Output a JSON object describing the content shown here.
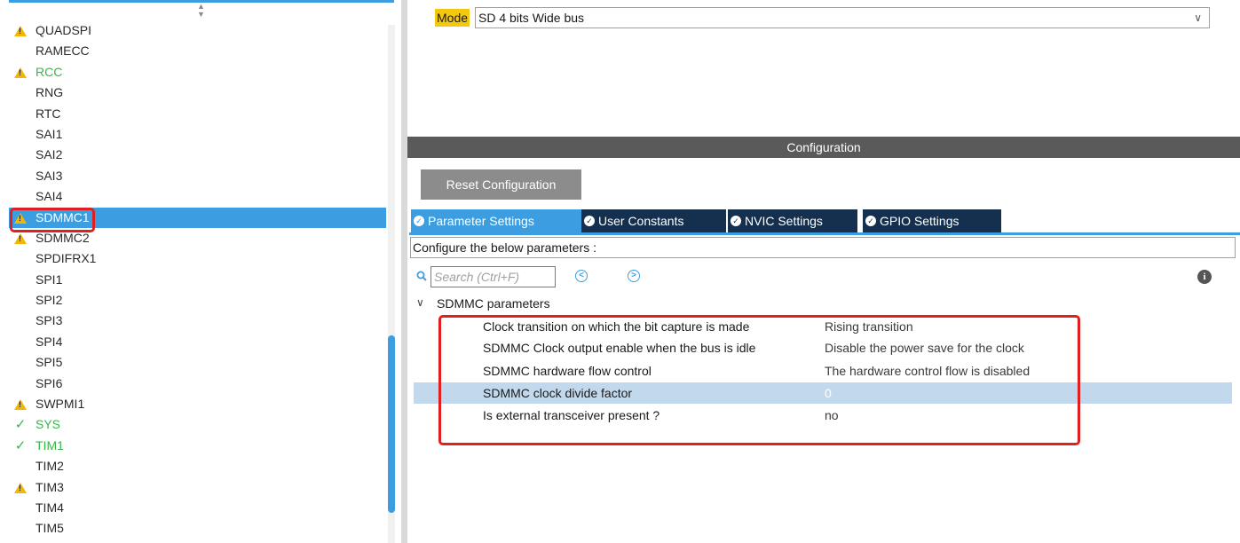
{
  "peripherals": [
    {
      "label": "QUADSPI",
      "status": "warning"
    },
    {
      "label": "RAMECC",
      "status": "none"
    },
    {
      "label": "RCC",
      "status": "warning",
      "color": "green"
    },
    {
      "label": "RNG",
      "status": "none"
    },
    {
      "label": "RTC",
      "status": "none"
    },
    {
      "label": "SAI1",
      "status": "none"
    },
    {
      "label": "SAI2",
      "status": "none"
    },
    {
      "label": "SAI3",
      "status": "none"
    },
    {
      "label": "SAI4",
      "status": "none"
    },
    {
      "label": "SDMMC1",
      "status": "warning",
      "selected": true
    },
    {
      "label": "SDMMC2",
      "status": "warning"
    },
    {
      "label": "SPDIFRX1",
      "status": "none"
    },
    {
      "label": "SPI1",
      "status": "none"
    },
    {
      "label": "SPI2",
      "status": "none"
    },
    {
      "label": "SPI3",
      "status": "none"
    },
    {
      "label": "SPI4",
      "status": "none"
    },
    {
      "label": "SPI5",
      "status": "none"
    },
    {
      "label": "SPI6",
      "status": "none"
    },
    {
      "label": "SWPMI1",
      "status": "warning"
    },
    {
      "label": "SYS",
      "status": "ok",
      "color": "green"
    },
    {
      "label": "TIM1",
      "status": "ok",
      "color": "green"
    },
    {
      "label": "TIM2",
      "status": "none"
    },
    {
      "label": "TIM3",
      "status": "warning"
    },
    {
      "label": "TIM4",
      "status": "none"
    },
    {
      "label": "TIM5",
      "status": "none"
    }
  ],
  "mode": {
    "label": "Mode",
    "value": "SD 4 bits Wide bus"
  },
  "configuration": {
    "header": "Configuration",
    "reset_label": "Reset Configuration",
    "tabs": [
      {
        "label": "Parameter Settings",
        "active": true
      },
      {
        "label": "User Constants",
        "active": false
      },
      {
        "label": "NVIC Settings",
        "active": false
      },
      {
        "label": "GPIO Settings",
        "active": false
      }
    ],
    "hint": "Configure the below parameters :",
    "search_placeholder": "Search (Ctrl+F)",
    "group_label": "SDMMC parameters",
    "params": [
      {
        "name": "Clock transition on which the bit capture is made",
        "value": "Rising transition"
      },
      {
        "name": "SDMMC Clock output enable when the bus is idle",
        "value": "Disable the power save for the clock"
      },
      {
        "name": "SDMMC hardware flow control",
        "value": "The hardware control flow is disabled"
      },
      {
        "name": "SDMMC clock divide factor",
        "value": "0",
        "selected": true
      },
      {
        "name": "Is external transceiver present ?",
        "value": "no"
      }
    ]
  },
  "colors": {
    "accent": "#3c9ee0",
    "tab_dark": "#15304e",
    "warning": "#f2b705",
    "ok": "#3bb44a",
    "highlight_red": "#e02020",
    "mode_label_bg": "#f2c811"
  }
}
